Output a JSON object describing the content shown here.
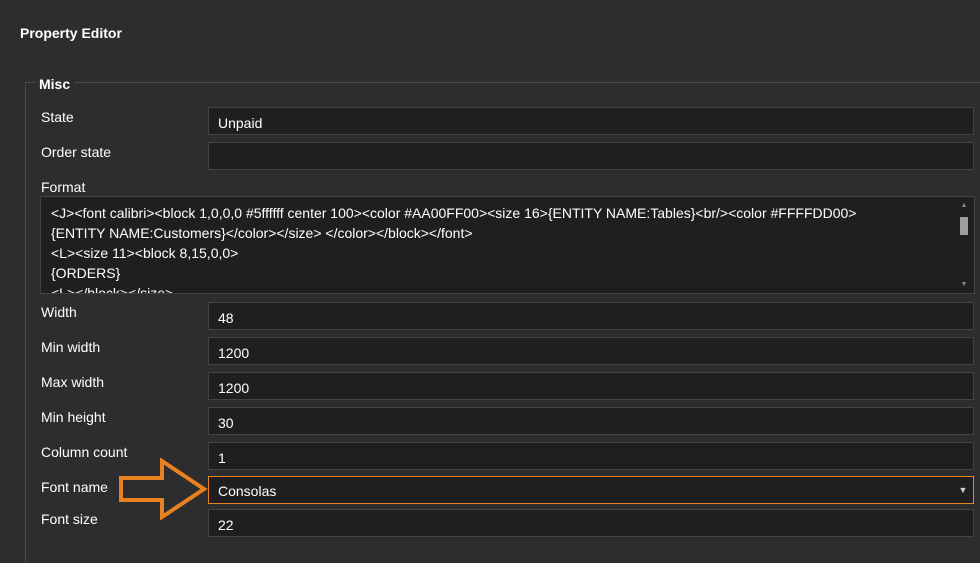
{
  "panel": {
    "title": "Property Editor"
  },
  "group": {
    "label": "Misc"
  },
  "fields": {
    "state": {
      "label": "State",
      "value": "Unpaid"
    },
    "order_state": {
      "label": "Order state",
      "value": ""
    },
    "format": {
      "label": "Format",
      "lines": [
        "<J><font calibri><block 1,0,0,0 #5ffffff center 100><color #AA00FF00><size 16>{ENTITY NAME:Tables}<br/><color #FFFFDD00>",
        "{ENTITY NAME:Customers}</color></size> </color></block></font>",
        "<L><size 11><block 8,15,0,0>",
        "{ORDERS}",
        "<L></block></size>"
      ]
    },
    "width": {
      "label": "Width",
      "value": "48"
    },
    "min_width": {
      "label": "Min width",
      "value": "1200"
    },
    "max_width": {
      "label": "Max width",
      "value": "1200"
    },
    "min_height": {
      "label": "Min height",
      "value": "30"
    },
    "column_count": {
      "label": "Column count",
      "value": "1"
    },
    "font_name": {
      "label": "Font name",
      "value": "Consolas"
    },
    "font_size": {
      "label": "Font size",
      "value": "22"
    }
  },
  "colors": {
    "accent": "#e8811f",
    "background": "#2d2d30",
    "field_bg": "#1f1f22"
  },
  "icons": {
    "dropdown": "chevron-down-icon",
    "annotation": "right-arrow-icon"
  }
}
